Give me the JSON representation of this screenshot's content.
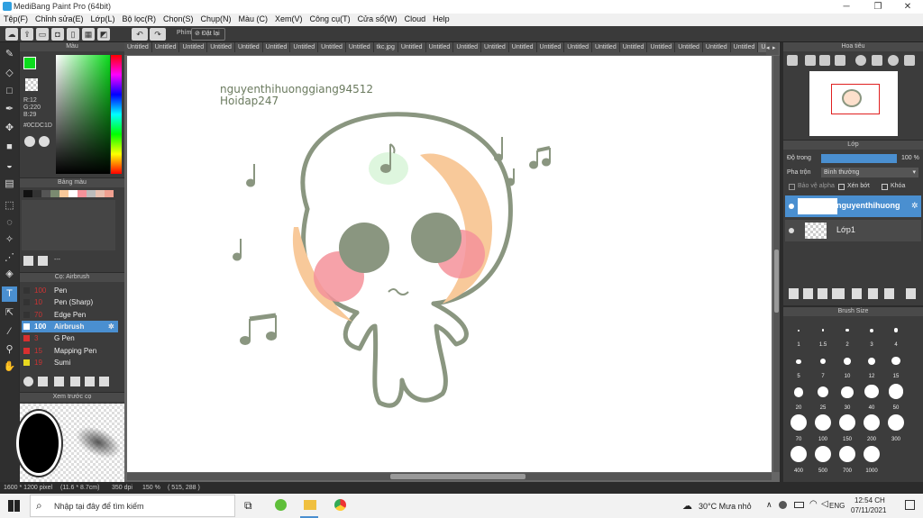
{
  "window": {
    "title": "MediBang Paint Pro (64bit)"
  },
  "menu": [
    "Tệp(F)",
    "Chỉnh sửa(E)",
    "Lớp(L)",
    "Bộ lọc(R)",
    "Chọn(S)",
    "Chụp(N)",
    "Màu (C)",
    "Xem(V)",
    "Công cụ(T)",
    "Cửa sổ(W)",
    "Cloud",
    "Help"
  ],
  "toolbar": {
    "key_label": "Phím",
    "reset_label": "Đặt lại"
  },
  "color_panel": {
    "title": "Màu",
    "r": "R:12",
    "g": "G:220",
    "b": "B:29",
    "hex": "#0CDC1D"
  },
  "palette_panel": {
    "title": "Bảng màu",
    "dash": "---"
  },
  "brush_panel": {
    "title": "Cọ: Airbrush",
    "items": [
      {
        "size": "100",
        "name": "Pen",
        "color": "#333333"
      },
      {
        "size": "10",
        "name": "Pen (Sharp)",
        "color": "#333333"
      },
      {
        "size": "70",
        "name": "Edge Pen",
        "color": "#333333"
      },
      {
        "size": "100",
        "name": "Airbrush",
        "color": "#ffffff",
        "selected": true
      },
      {
        "size": "3",
        "name": "G Pen",
        "color": "#d83030"
      },
      {
        "size": "15",
        "name": "Mapping Pen",
        "color": "#d83030"
      },
      {
        "size": "19",
        "name": "Sumi",
        "color": "#e8d820"
      }
    ]
  },
  "preview_panel": {
    "title": "Xem trước cọ"
  },
  "tabs": [
    "Untitled",
    "Untitled",
    "Untitled",
    "Untitled",
    "Untitled",
    "Untitled",
    "Untitled",
    "Untitled",
    "Untitled",
    "tkc.jpg",
    "Untitled",
    "Untitled",
    "Untitled",
    "Untitled",
    "Untitled",
    "Untitled",
    "Untitled",
    "Untitled",
    "Untitled",
    "Untitled",
    "Untitled",
    "Untitled",
    "Untitled",
    "Untitled"
  ],
  "canvas": {
    "line1": "nguyenthihuonggiang94512",
    "line2": "Hoidap247"
  },
  "navigator": {
    "title": "Hoa tiêu"
  },
  "layer_panel": {
    "title": "Lớp",
    "opacity_label": "Độ trong",
    "opacity_value": "100 %",
    "blend_label": "Pha trộn",
    "blend_value": "Bình thường",
    "alpha_label": "Bảo vệ alpha",
    "clip_label": "Xén bớt",
    "lock_label": "Khóa",
    "layers": [
      {
        "name": "nguyenthihuong",
        "selected": true
      },
      {
        "name": "Lớp1",
        "selected": false
      }
    ]
  },
  "brush_size_panel": {
    "title": "Brush Size",
    "sizes": [
      "1",
      "1.5",
      "2",
      "3",
      "4",
      "5",
      "7",
      "10",
      "12",
      "15",
      "20",
      "25",
      "30",
      "40",
      "50",
      "70",
      "100",
      "150",
      "200",
      "300",
      "400",
      "500",
      "700",
      "1000"
    ]
  },
  "status": {
    "dims": "1600 * 1200 pixel",
    "cm": "(11.6 * 8.7cm)",
    "dpi": "350 dpi",
    "zoom": "150 %",
    "coords": "( 515, 288 )"
  },
  "taskbar": {
    "search": "Nhập tại đây để tìm kiếm",
    "weather": "30°C  Mưa nhỏ",
    "lang": "ENG",
    "time": "12:54 CH",
    "date": "07/11/2021"
  },
  "colors": {
    "accent": "#0CDC1D",
    "selection": "#4a8fd0",
    "outline": "#8a9680",
    "orange": "#f8c99a",
    "pink": "#f4929a"
  }
}
